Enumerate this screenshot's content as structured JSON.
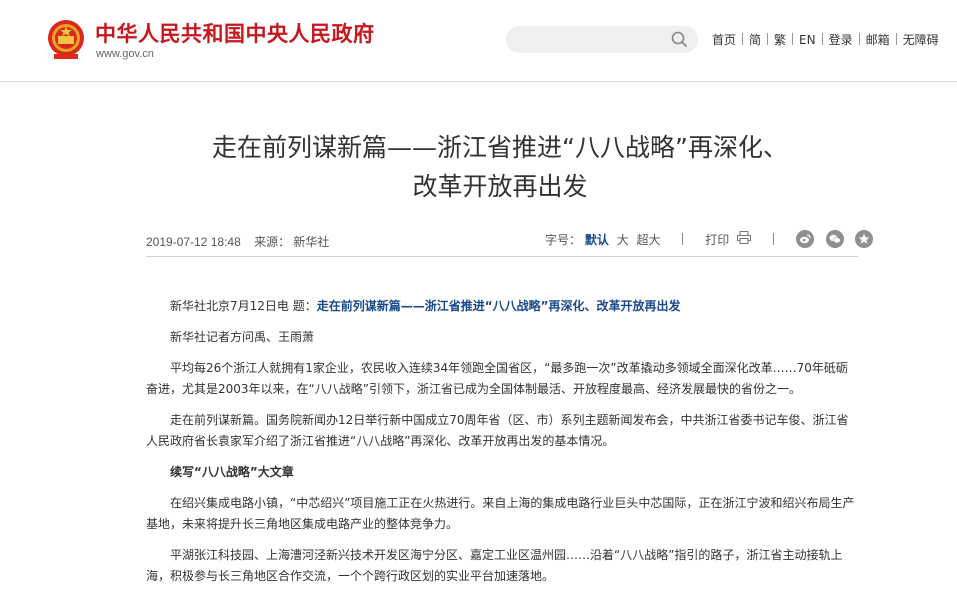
{
  "header": {
    "site_title": "中华人民共和国中央人民政府",
    "site_url": "www.gov.cn",
    "search": {
      "placeholder": ""
    },
    "nav": [
      "首页",
      "简",
      "繁",
      "EN",
      "登录",
      "邮箱",
      "无障碍"
    ]
  },
  "article": {
    "title_line1": "走在前列谋新篇——浙江省推进“八八战略”再深化、",
    "title_line2": "改革开放再出发",
    "date": "2019-07-12 18:48",
    "source": "来源：  新华社",
    "font_size_label": "字号：",
    "font_sizes": [
      "默认",
      "大",
      "超大"
    ],
    "print_label": "打印",
    "lead_prefix": "新华社北京7月12日电  题：",
    "lead_link": "走在前列谋新篇——浙江省推进“八八战略”再深化、改革开放再出发",
    "paragraphs": [
      "新华社记者方问禹、王雨萧",
      "平均每26个浙江人就拥有1家企业，农民收入连续34年领跑全国省区，“最多跑一次”改革撬动多领域全面深化改革……70年砥砺奋进，尤其是2003年以来，在“八八战略”引领下，浙江省已成为全国体制最活、开放程度最高、经济发展最快的省份之一。",
      "走在前列谋新篇。国务院新闻办12日举行新中国成立70周年省（区、市）系列主题新闻发布会，中共浙江省委书记车俊、浙江省人民政府省长袁家军介绍了浙江省推进“八八战略”再深化、改革开放再出发的基本情况。",
      "续写“八八战略”大文章",
      "在绍兴集成电路小镇，“中芯绍兴”项目施工正在火热进行。来自上海的集成电路行业巨头中芯国际，正在浙江宁波和绍兴布局生产基地，未来将提升长三角地区集成电路产业的整体竞争力。",
      "平湖张江科技园、上海漕河泾新兴技术开发区海宁分区、嘉定工业区温州园……沿着“八八战略”指引的路子，浙江省主动接轨上海，积极参与长三角地区合作交流，一个个跨行政区划的实业平台加速落地。"
    ]
  },
  "colors": {
    "brand_red": "#c8161d",
    "link_blue": "#1a4a8c"
  },
  "icons": [
    "national-emblem-icon",
    "search-icon",
    "print-icon",
    "weibo-icon",
    "wechat-icon",
    "favorite-star-icon"
  ]
}
